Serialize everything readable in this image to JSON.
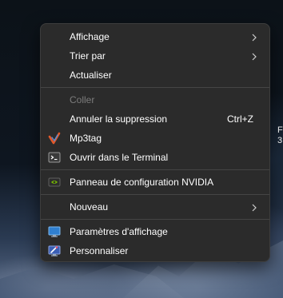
{
  "desktop": {
    "edge_text_line1": "F",
    "edge_text_line2": "3"
  },
  "context_menu": {
    "items": [
      {
        "label": "Affichage",
        "submenu": true
      },
      {
        "label": "Trier par",
        "submenu": true
      },
      {
        "label": "Actualiser"
      },
      {
        "label": "Coller",
        "disabled": true
      },
      {
        "label": "Annuler la suppression",
        "shortcut": "Ctrl+Z"
      },
      {
        "label": "Mp3tag",
        "icon": "mp3tag-icon"
      },
      {
        "label": "Ouvrir dans le Terminal",
        "icon": "terminal-icon"
      },
      {
        "label": "Panneau de configuration NVIDIA",
        "icon": "nvidia-icon"
      },
      {
        "label": "Nouveau",
        "submenu": true
      },
      {
        "label": "Paramètres d'affichage",
        "icon": "display-settings-icon"
      },
      {
        "label": "Personnaliser",
        "icon": "personalize-icon"
      }
    ]
  },
  "colors": {
    "menu_background": "#2b2b2b",
    "menu_border": "#3d3d3d",
    "text": "#ffffff",
    "disabled_text": "#7c7c7c",
    "separator": "#454545"
  }
}
